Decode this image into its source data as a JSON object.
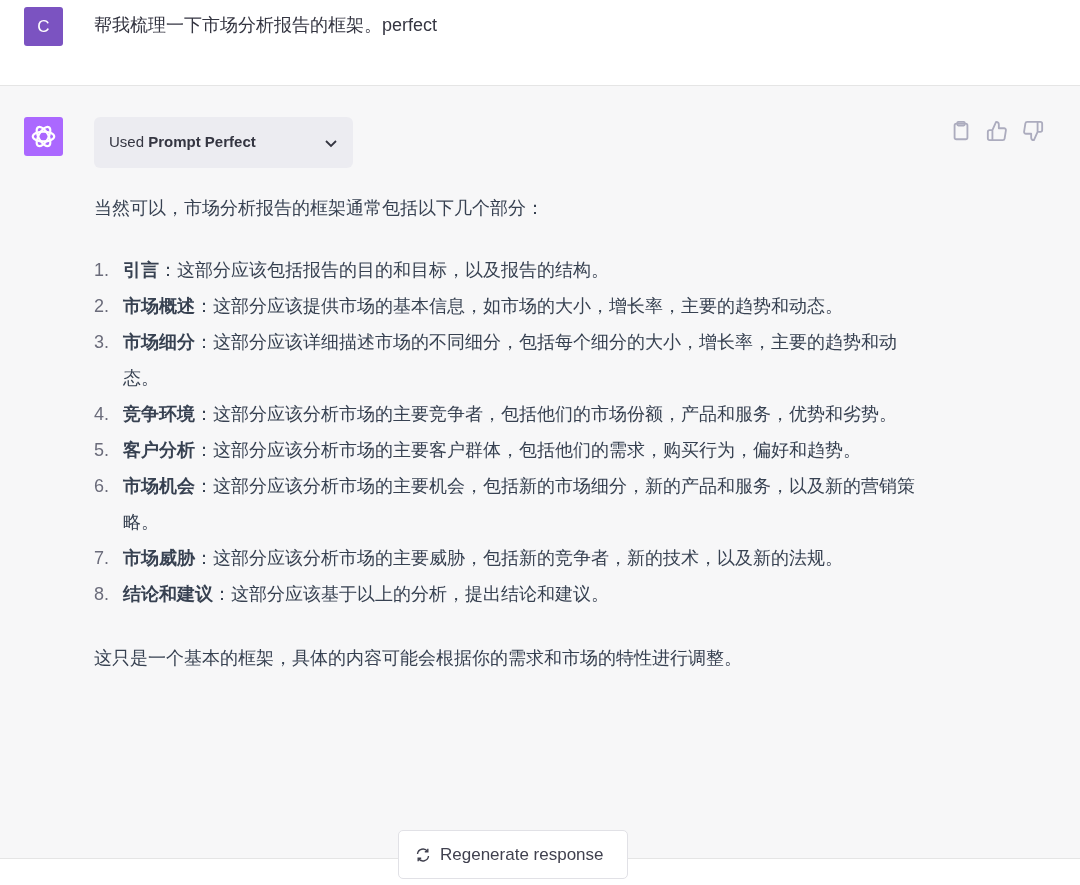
{
  "user_message": {
    "avatar": "C",
    "text": "帮我梳理一下市场分析报告的框架。perfect"
  },
  "assistant_message": {
    "plugin": {
      "prefix": "Used",
      "name": "Prompt Perfect",
      "expanded": false
    },
    "intro": "当然可以，市场分析报告的框架通常包括以下几个部分：",
    "items": [
      {
        "number": "1.",
        "text": "**引言**：这部分应该包括报告的目的和目标，以及报告的结构。"
      },
      {
        "number": "2.",
        "text": "**市场概述**：这部分应该提供市场的基本信息，如市场的大小，增长率，主要的趋势和动态。"
      },
      {
        "number": "3.",
        "text": "**市场细分**：这部分应该详细描述市场的不同细分，包括每个细分的大小，增长率，主要的趋势和动态。"
      },
      {
        "number": "4.",
        "text": "**竞争环境**：这部分应该分析市场的主要竞争者，包括他们的市场份额，产品和服务，优势和劣势。"
      },
      {
        "number": "5.",
        "text": "**客户分析**：这部分应该分析市场的主要客户群体，包括他们的需求，购买行为，偏好和趋势。"
      },
      {
        "number": "6.",
        "text": "**市场机会**：这部分应该分析市场的主要机会，包括新的市场细分，新的产品和服务，以及新的营销策略。"
      },
      {
        "number": "7.",
        "text": "**市场威胁**：这部分应该分析市场的主要威胁，包括新的竞争者，新的技术，以及新的法规。"
      },
      {
        "number": "8.",
        "text": "**结论和建议**：这部分应该基于以上的分析，提出结论和建议。"
      }
    ],
    "closing": "这只是一个基本的框架，具体的内容可能会根据你的需求和市场的特性进行调整。"
  },
  "regenerate_button": "Regenerate response"
}
